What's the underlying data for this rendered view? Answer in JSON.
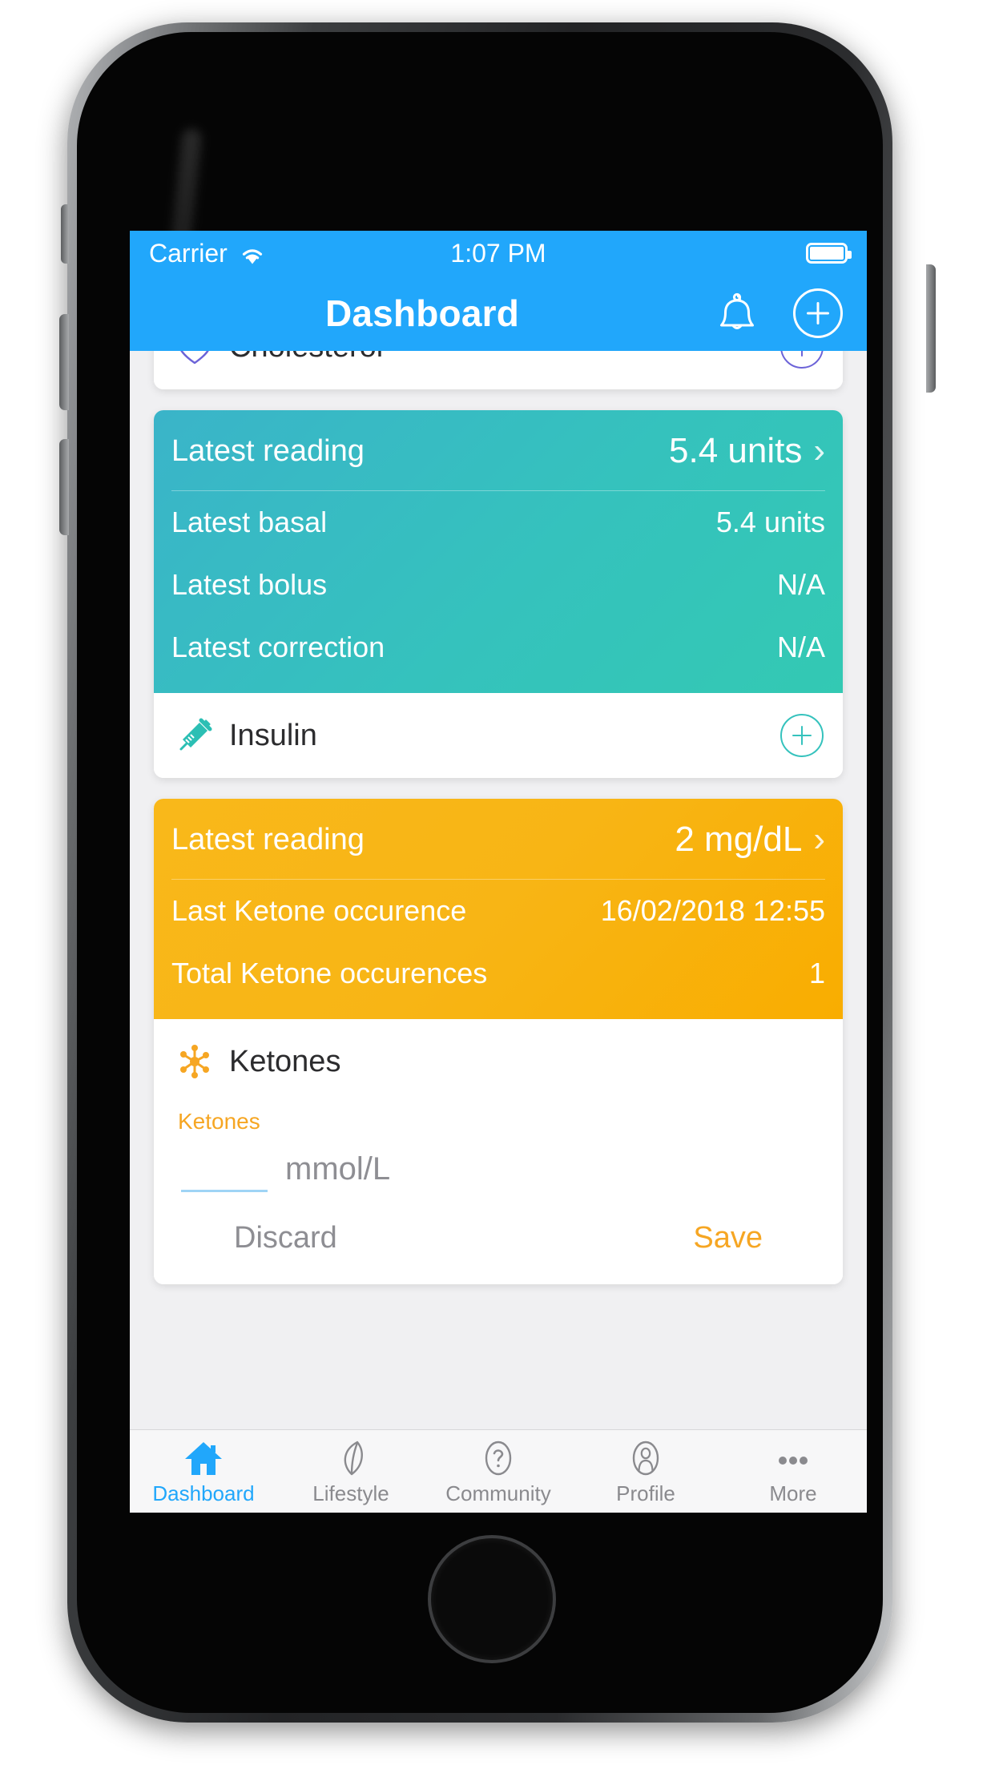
{
  "statusbar": {
    "carrier": "Carrier",
    "wifi_icon": "wifi-icon",
    "time": "1:07 PM",
    "battery_icon": "battery-full-icon"
  },
  "navbar": {
    "title": "Dashboard",
    "bell_icon": "bell-icon",
    "add_icon": "plus-circle-icon"
  },
  "cards": {
    "cholesterol": {
      "name": "Cholesterol",
      "icon": "heart-outline-icon",
      "accent": "#6c63d8",
      "add_icon": "plus-circle-icon"
    },
    "insulin": {
      "summary": {
        "latest_label": "Latest reading",
        "latest_value": "5.4 units",
        "chevron": "›",
        "rows": [
          {
            "label": "Latest basal",
            "value": "5.4 units"
          },
          {
            "label": "Latest bolus",
            "value": "N/A"
          },
          {
            "label": "Latest correction",
            "value": "N/A"
          }
        ]
      },
      "name": "Insulin",
      "icon": "syringe-icon",
      "accent": "#35c2bd",
      "add_icon": "plus-circle-icon"
    },
    "ketones": {
      "summary": {
        "latest_label": "Latest reading",
        "latest_value": "2 mg/dL",
        "chevron": "›",
        "rows": [
          {
            "label": "Last Ketone occurence",
            "value": "16/02/2018 12:55"
          },
          {
            "label": "Total Ketone occurences",
            "value": "1"
          }
        ]
      },
      "name": "Ketones",
      "icon": "molecule-icon",
      "accent": "#f6a623",
      "form": {
        "field_label": "Ketones",
        "input_value": "",
        "input_placeholder": "",
        "unit": "mmol/L",
        "discard_label": "Discard",
        "save_label": "Save"
      }
    }
  },
  "tabbar": {
    "items": [
      {
        "label": "Dashboard",
        "icon": "home-icon",
        "active": true
      },
      {
        "label": "Lifestyle",
        "icon": "leaf-icon",
        "active": false
      },
      {
        "label": "Community",
        "icon": "question-icon",
        "active": false
      },
      {
        "label": "Profile",
        "icon": "person-icon",
        "active": false
      },
      {
        "label": "More",
        "icon": "ellipsis-icon",
        "active": false
      }
    ]
  },
  "colors": {
    "brand_blue": "#21a7fb",
    "teal": "#35c2bd",
    "orange": "#f9b516",
    "purple": "#6c63d8",
    "muted": "#8e8e93"
  }
}
